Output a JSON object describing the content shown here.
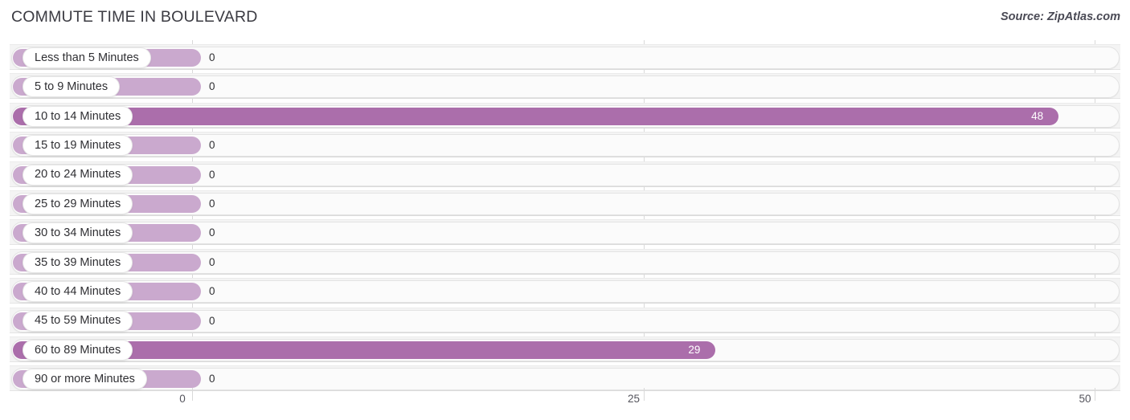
{
  "header": {
    "title": "COMMUTE TIME IN BOULEVARD",
    "source": "Source: ZipAtlas.com"
  },
  "chart_data": {
    "type": "bar",
    "orientation": "horizontal",
    "title": "COMMUTE TIME IN BOULEVARD",
    "xlabel": "",
    "ylabel": "",
    "xlim": [
      0,
      50
    ],
    "xticks": [
      "0",
      "25",
      "50"
    ],
    "xtick_values": [
      0,
      25,
      50
    ],
    "grid": true,
    "legend": "none",
    "categories": [
      "Less than 5 Minutes",
      "5 to 9 Minutes",
      "10 to 14 Minutes",
      "15 to 19 Minutes",
      "20 to 24 Minutes",
      "25 to 29 Minutes",
      "30 to 34 Minutes",
      "35 to 39 Minutes",
      "40 to 44 Minutes",
      "45 to 59 Minutes",
      "60 to 89 Minutes",
      "90 or more Minutes"
    ],
    "values": [
      0,
      0,
      48,
      0,
      0,
      0,
      0,
      0,
      0,
      0,
      29,
      0
    ],
    "value_labels": [
      "0",
      "0",
      "48",
      "0",
      "0",
      "0",
      "0",
      "0",
      "0",
      "0",
      "29",
      "0"
    ]
  },
  "colors": {
    "bar_active": "#ab6eab",
    "bar_zero": "#caa9ce",
    "row_background": "#f4f4f4",
    "track_background": "#fbfbfb",
    "gridline": "#d9d9d9",
    "text": "#2f2f33",
    "value_inside_text": "#ffffff"
  },
  "rows": [
    {
      "label": "Less than 5 Minutes",
      "value": 0,
      "value_label": "0"
    },
    {
      "label": "5 to 9 Minutes",
      "value": 0,
      "value_label": "0"
    },
    {
      "label": "10 to 14 Minutes",
      "value": 48,
      "value_label": "48"
    },
    {
      "label": "15 to 19 Minutes",
      "value": 0,
      "value_label": "0"
    },
    {
      "label": "20 to 24 Minutes",
      "value": 0,
      "value_label": "0"
    },
    {
      "label": "25 to 29 Minutes",
      "value": 0,
      "value_label": "0"
    },
    {
      "label": "30 to 34 Minutes",
      "value": 0,
      "value_label": "0"
    },
    {
      "label": "35 to 39 Minutes",
      "value": 0,
      "value_label": "0"
    },
    {
      "label": "40 to 44 Minutes",
      "value": 0,
      "value_label": "0"
    },
    {
      "label": "45 to 59 Minutes",
      "value": 0,
      "value_label": "0"
    },
    {
      "label": "60 to 89 Minutes",
      "value": 29,
      "value_label": "29"
    },
    {
      "label": "90 or more Minutes",
      "value": 0,
      "value_label": "0"
    }
  ],
  "axis": {
    "ticks": [
      {
        "label": "0",
        "value": 0
      },
      {
        "label": "25",
        "value": 25
      },
      {
        "label": "50",
        "value": 50
      }
    ]
  }
}
